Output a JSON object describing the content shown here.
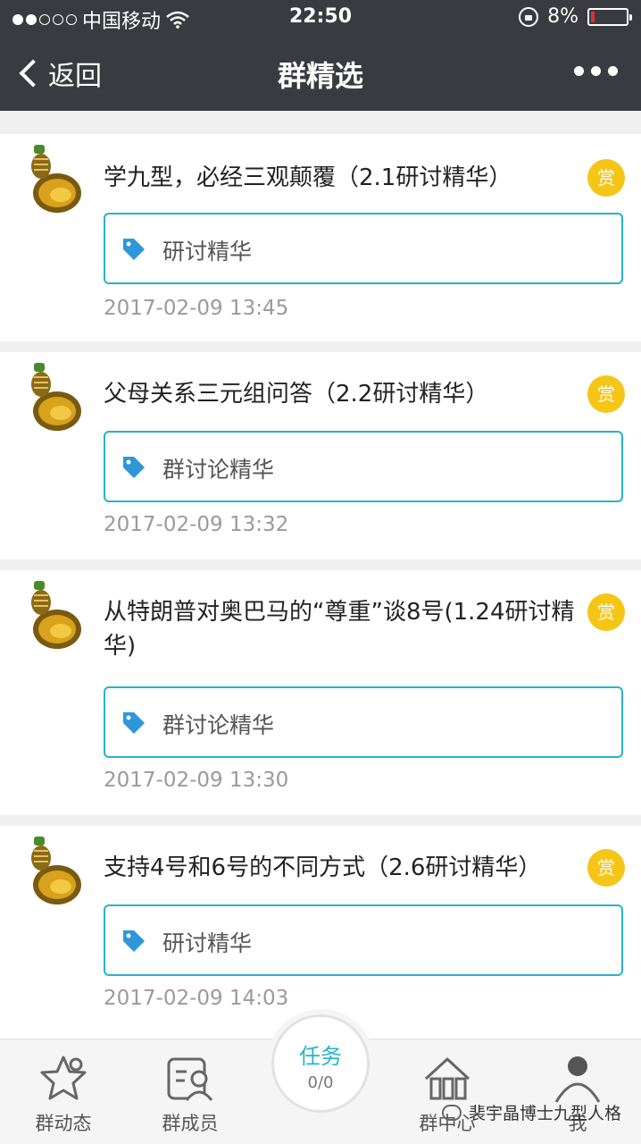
{
  "status_bar": {
    "carrier": "中国移动",
    "time": "22:50",
    "battery": "8%",
    "battery_level": 0.08
  },
  "nav": {
    "back_label": "返回",
    "title": "群精选"
  },
  "posts": [
    {
      "title": "学九型，必经三观颠覆（2.1研讨精华）",
      "reward": "赏",
      "tag": "研讨精华",
      "time": "2017-02-09 13:45"
    },
    {
      "title": "父母关系三元组问答（2.2研讨精华）",
      "reward": "赏",
      "tag": "群讨论精华",
      "time": "2017-02-09 13:32"
    },
    {
      "title": "从特朗普对奥巴马的“尊重”谈8号(1.24研讨精华)",
      "reward": "赏",
      "tag": "群讨论精华",
      "time": "2017-02-09 13:30"
    },
    {
      "title": "支持4号和6号的不同方式（2.6研讨精华）",
      "reward": "赏",
      "tag": "研讨精华",
      "time": "2017-02-09 14:03"
    }
  ],
  "tabbar": {
    "feed": "群动态",
    "members": "群成员",
    "task_label": "任务",
    "task_count": "0/0",
    "center": "群中心",
    "me": "我"
  },
  "watermark": "裴宇晶博士九型人格",
  "colors": {
    "header_bg": "#3a3b40",
    "accent": "#28b3c9",
    "reward": "#f5c518"
  }
}
